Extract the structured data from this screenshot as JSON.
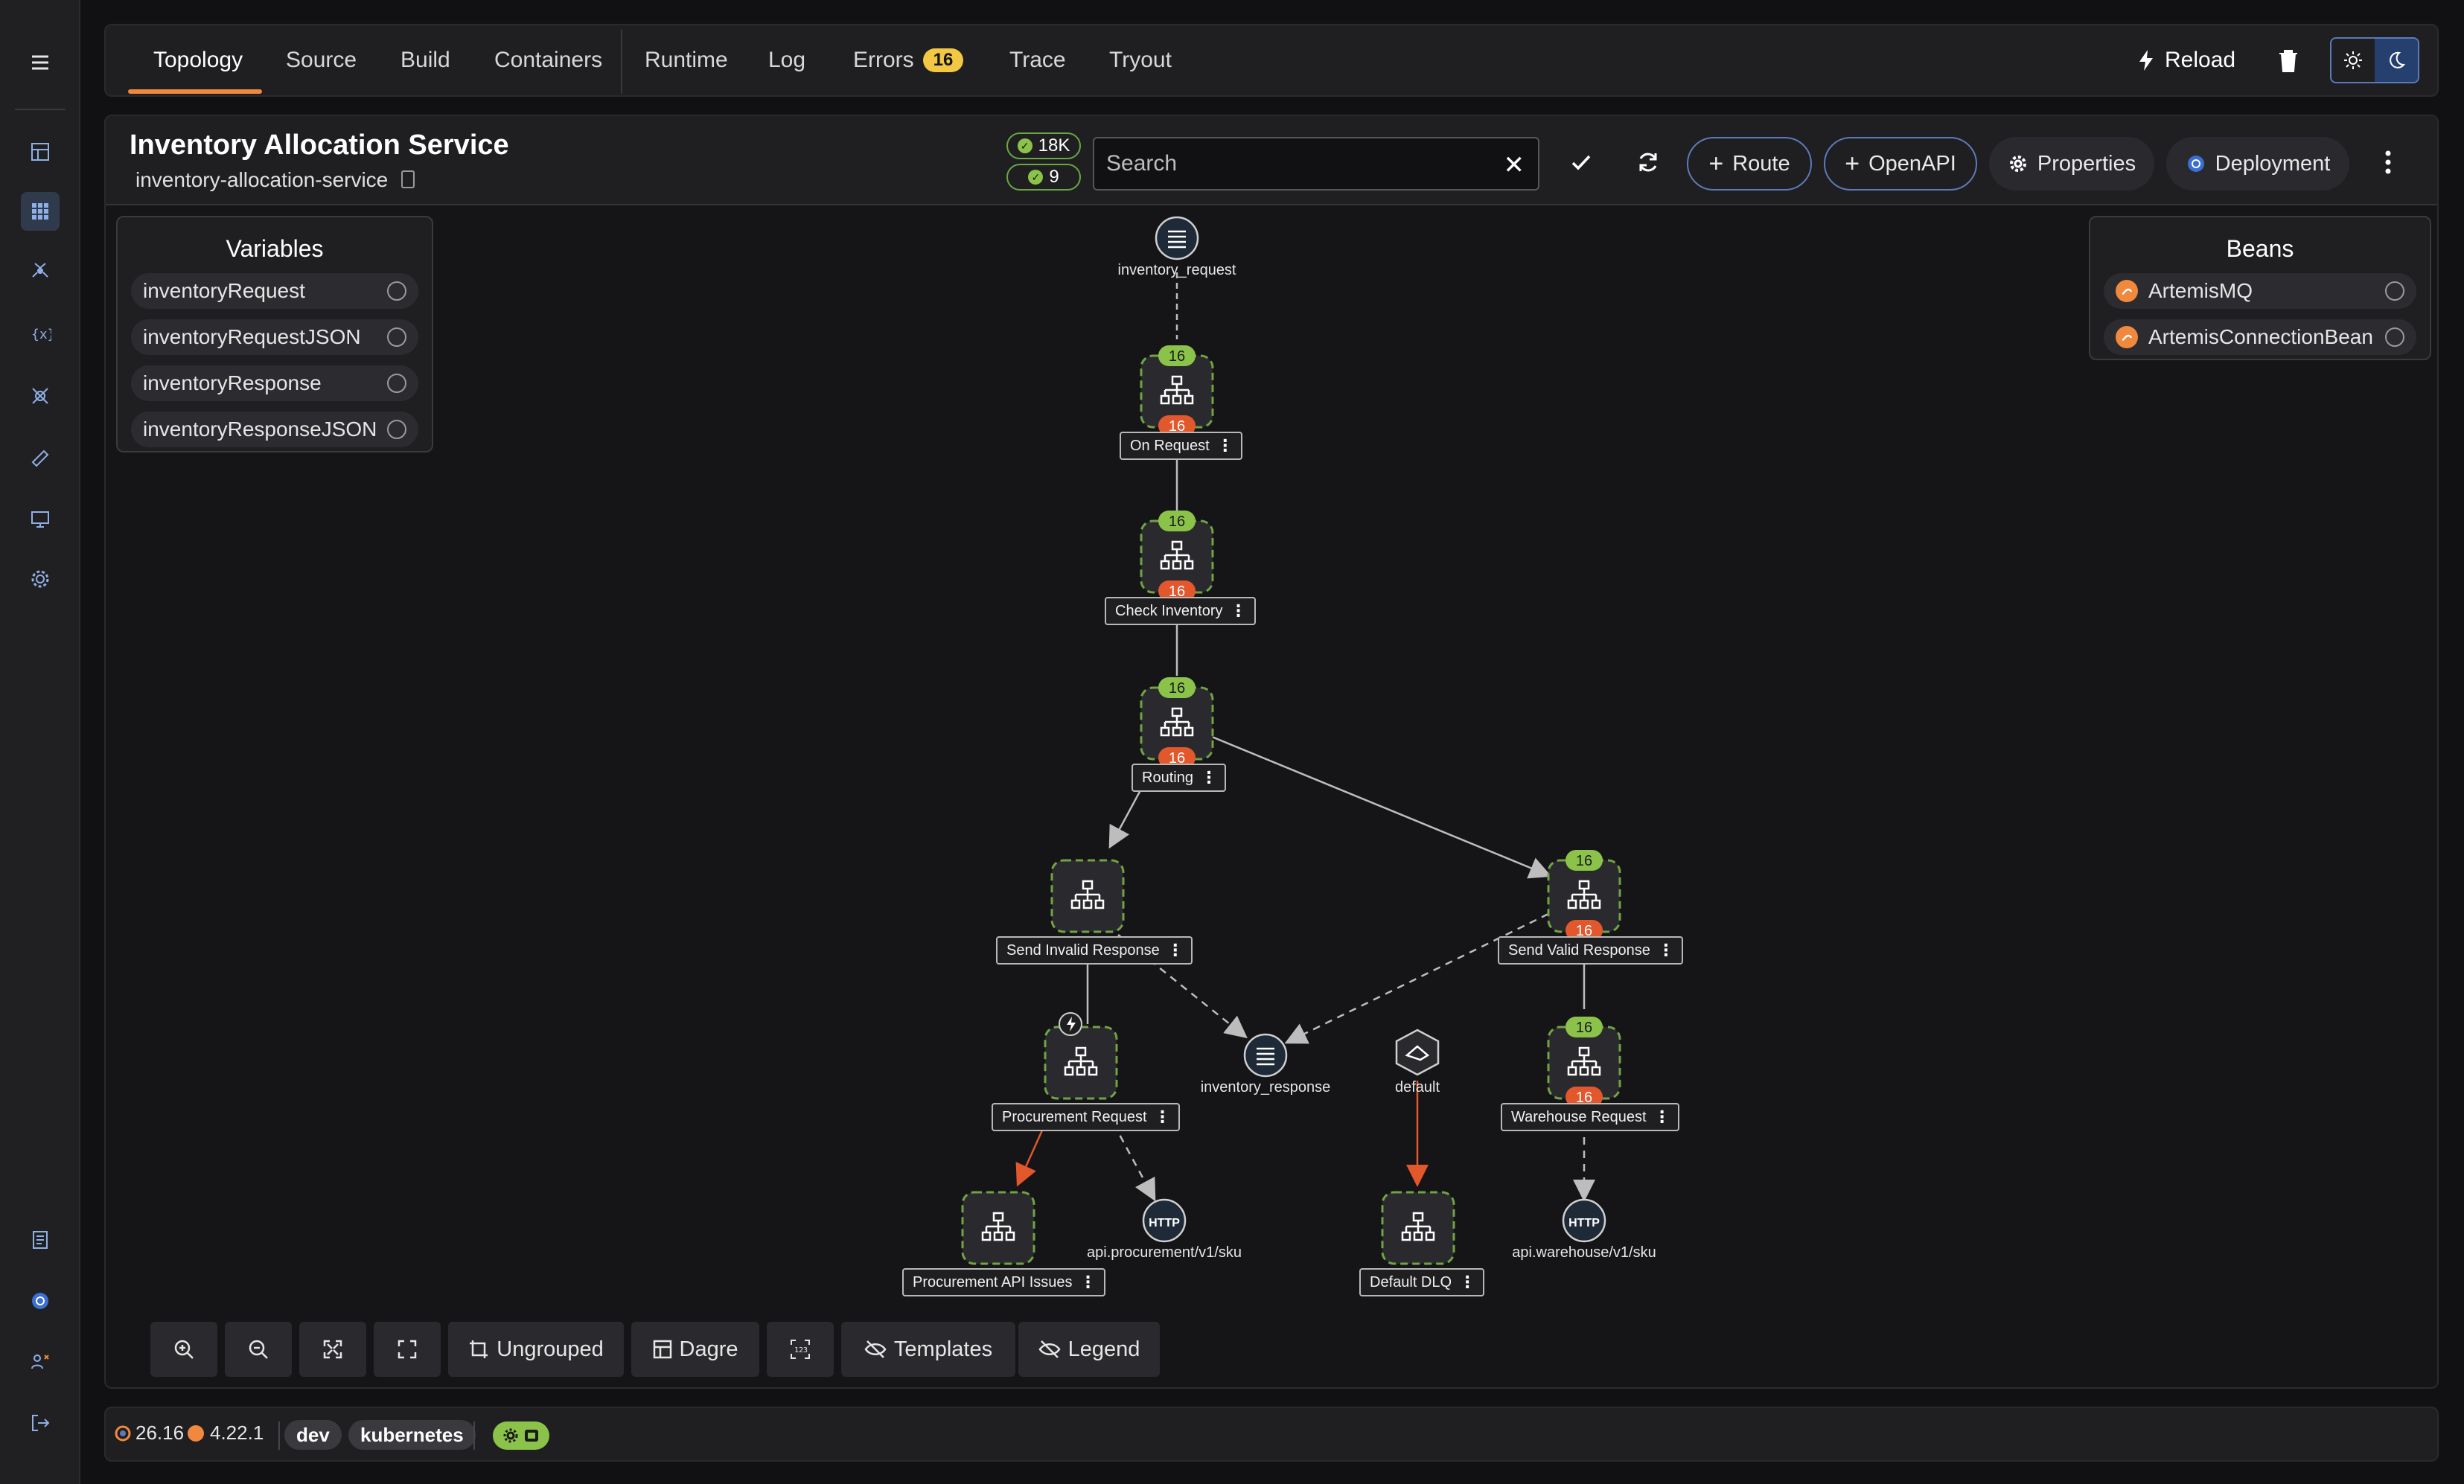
{
  "rail": {
    "icons": [
      "menu-icon",
      "dashboard-icon",
      "topology-grid-icon",
      "integrations-icon",
      "kamelets-icon",
      "services-icon",
      "knowledge-icon",
      "monitor-icon",
      "settings-icon",
      "docs-icon",
      "kubernetes-icon",
      "access-icon",
      "logout-icon"
    ]
  },
  "tabs": {
    "topology": "Topology",
    "source": "Source",
    "build": "Build",
    "containers": "Containers",
    "runtime": "Runtime",
    "log": "Log",
    "errors": "Errors",
    "errors_count": "16",
    "trace": "Trace",
    "tryout": "Tryout",
    "reload": "Reload"
  },
  "header": {
    "title": "Inventory Allocation Service",
    "subtitle": "inventory-allocation-service",
    "count_total": "18K",
    "count_ok": "9",
    "search_placeholder": "Search",
    "route_label": "Route",
    "openapi_label": "OpenAPI",
    "properties_label": "Properties",
    "deployment_label": "Deployment"
  },
  "variables": {
    "title": "Variables",
    "items": [
      "inventoryRequest",
      "inventoryRequestJSON",
      "inventoryResponse",
      "inventoryResponseJSON"
    ]
  },
  "beans": {
    "title": "Beans",
    "items": [
      "ArtemisMQ",
      "ArtemisConnectionBean"
    ]
  },
  "graph": {
    "inventory_request": "inventory_request",
    "on_request": "On Request",
    "check_inventory": "Check Inventory",
    "routing": "Routing",
    "send_invalid": "Send Invalid Response",
    "send_valid": "Send Valid Response",
    "procurement_request": "Procurement Request",
    "inventory_response": "inventory_response",
    "default_source": "default",
    "warehouse_request": "Warehouse Request",
    "procurement_api_issues": "Procurement API Issues",
    "api_procurement": "api.procurement/v1/sku",
    "default_dlq": "Default DLQ",
    "api_warehouse": "api.warehouse/v1/sku",
    "http_badge": "HTTP",
    "count": "16"
  },
  "toolbar": {
    "ungrouped": "Ungrouped",
    "dagre": "Dagre",
    "templates": "Templates",
    "legend": "Legend"
  },
  "footer": {
    "version_a": "26.16",
    "version_b": "4.22.1",
    "env": "dev",
    "platform": "kubernetes"
  },
  "colors": {
    "accent_orange": "#f0883e",
    "success_green": "#8bc34a",
    "error_red": "#e2572b",
    "warning_yellow": "#f2c744",
    "blue_outline": "#5b7ab8"
  }
}
